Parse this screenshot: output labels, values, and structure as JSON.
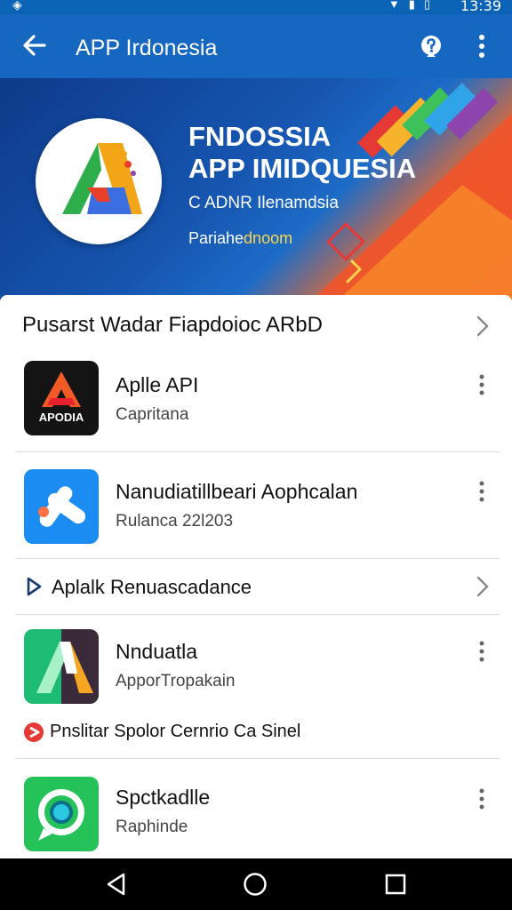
{
  "status_bar": {
    "time": "13:39"
  },
  "app_bar": {
    "title": "APP Irdonesia"
  },
  "hero": {
    "title_line1": "FNDOSSIA",
    "title_line2": "APP IMIDQUESIA",
    "subtitle": "C ADNR Ilenamdsia",
    "tagline_start": "Pariahe",
    "tagline_end": "dnoom"
  },
  "section": {
    "title": "Pusarst Wadar Fiapdoioc ARbD"
  },
  "apps": [
    {
      "name": "Aplle API",
      "subtitle": "Capritana",
      "icon_text": "APODIA"
    },
    {
      "name": "Nanudiatillbeari Aophcalan",
      "subtitle": "Rulanca 22l203"
    },
    {
      "name": "Nnduatla",
      "subtitle": "ApporTropakain"
    },
    {
      "name": "Spctkadlle",
      "subtitle": "Raphinde"
    }
  ],
  "links": [
    {
      "label": "Aplalk Renuascadance"
    },
    {
      "label": "Pnslitar Spolor Cernrio Ca Sinel"
    }
  ],
  "colors": {
    "app_bar": "#1567c0",
    "status_bar": "#0b63b6",
    "hero_blue": "#1655b0",
    "hero_orange": "#f26a2a",
    "divider": "#dcdcdc",
    "nav_bar": "#000000"
  },
  "icons": [
    "back-arrow-icon",
    "help-icon",
    "more-vert-icon",
    "chevron-right-icon",
    "play-triangle-icon",
    "red-badge-icon",
    "nav-back-icon",
    "nav-home-icon",
    "nav-recents-icon"
  ]
}
